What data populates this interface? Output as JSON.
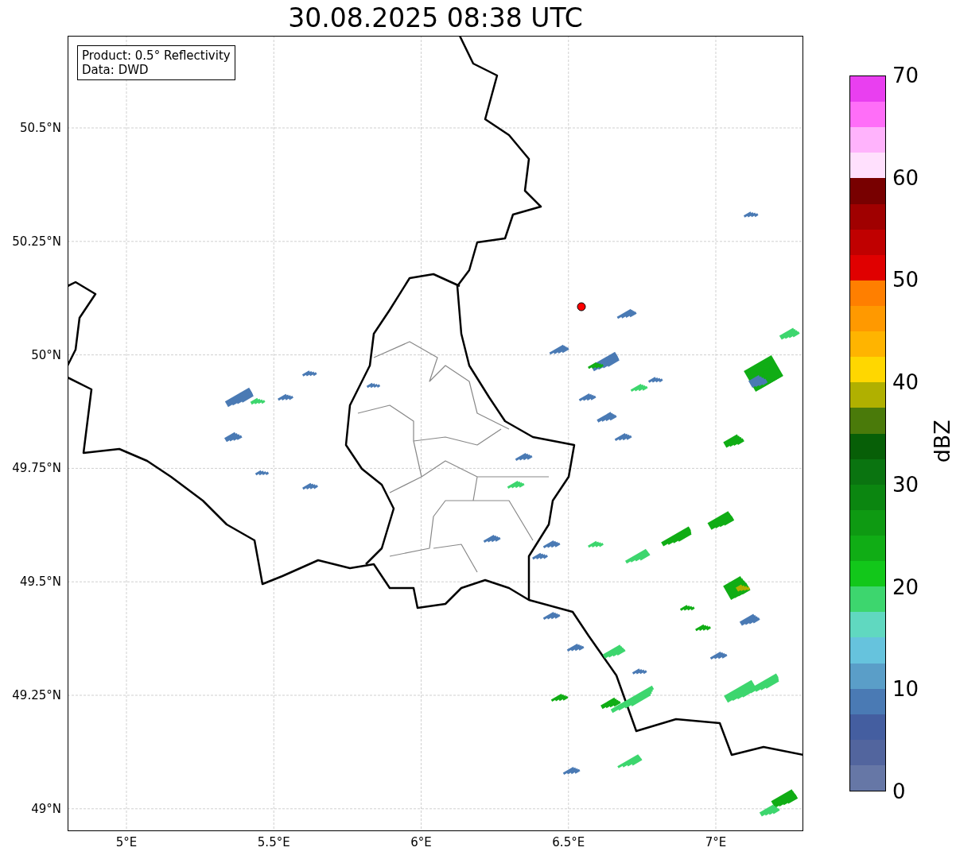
{
  "title": "30.08.2025 08:38 UTC",
  "info_box": {
    "lines": [
      "Product: 0.5° Reflectivity",
      "Data: DWD"
    ]
  },
  "map": {
    "xticks": [
      "5°E",
      "5.5°E",
      "6°E",
      "6.5°E",
      "7°E"
    ],
    "yticks": [
      "50.5°N",
      "50.25°N",
      "50°N",
      "49.75°N",
      "49.5°N",
      "49.25°N",
      "49°N"
    ]
  },
  "colorbar": {
    "label": "dBZ",
    "ticks": [
      "70",
      "60",
      "50",
      "40",
      "30",
      "20",
      "10",
      "0"
    ],
    "bands": [
      {
        "color": "#e93ff0"
      },
      {
        "color": "#ff6ef8"
      },
      {
        "color": "#ffb3fc"
      },
      {
        "color": "#ffe0fd"
      },
      {
        "color": "#780000"
      },
      {
        "color": "#a00000"
      },
      {
        "color": "#c00000"
      },
      {
        "color": "#e00000"
      },
      {
        "color": "#ff7f00"
      },
      {
        "color": "#ff9900"
      },
      {
        "color": "#ffb400"
      },
      {
        "color": "#ffd700"
      },
      {
        "color": "#b0b000"
      },
      {
        "color": "#4a7a0a"
      },
      {
        "color": "#075f07"
      },
      {
        "color": "#0a7410"
      },
      {
        "color": "#0b8610"
      },
      {
        "color": "#0e9a12"
      },
      {
        "color": "#10ad15"
      },
      {
        "color": "#12c71a"
      },
      {
        "color": "#3dd66e"
      },
      {
        "color": "#60d8c0"
      },
      {
        "color": "#66c3dd"
      },
      {
        "color": "#5a9ec8"
      },
      {
        "color": "#4a7ab4"
      },
      {
        "color": "#445ea0"
      },
      {
        "color": "#52659e"
      },
      {
        "color": "#6677a6"
      }
    ]
  }
}
